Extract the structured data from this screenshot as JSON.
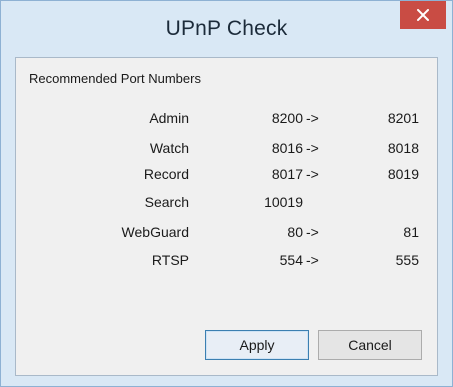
{
  "window": {
    "title": "UPnP Check",
    "close_icon": "close-icon"
  },
  "section": {
    "title": "Recommended Port Numbers"
  },
  "ports": [
    {
      "name": "Admin",
      "from": "8200",
      "arrow": "->",
      "to": "8201"
    },
    {
      "name": "Watch",
      "from": "8016",
      "arrow": "->",
      "to": "8018"
    },
    {
      "name": "Record",
      "from": "8017",
      "arrow": "->",
      "to": "8019"
    },
    {
      "name": "Search",
      "from": "10019",
      "arrow": "",
      "to": ""
    },
    {
      "name": "WebGuard",
      "from": "80",
      "arrow": "->",
      "to": "81"
    },
    {
      "name": "RTSP",
      "from": "554",
      "arrow": "->",
      "to": "555"
    }
  ],
  "buttons": {
    "apply": "Apply",
    "cancel": "Cancel"
  },
  "colors": {
    "titlebar": "#d9e8f5",
    "close_button": "#c94c44",
    "client": "#f0f0f0",
    "default_button_border": "#3c7fb1"
  }
}
